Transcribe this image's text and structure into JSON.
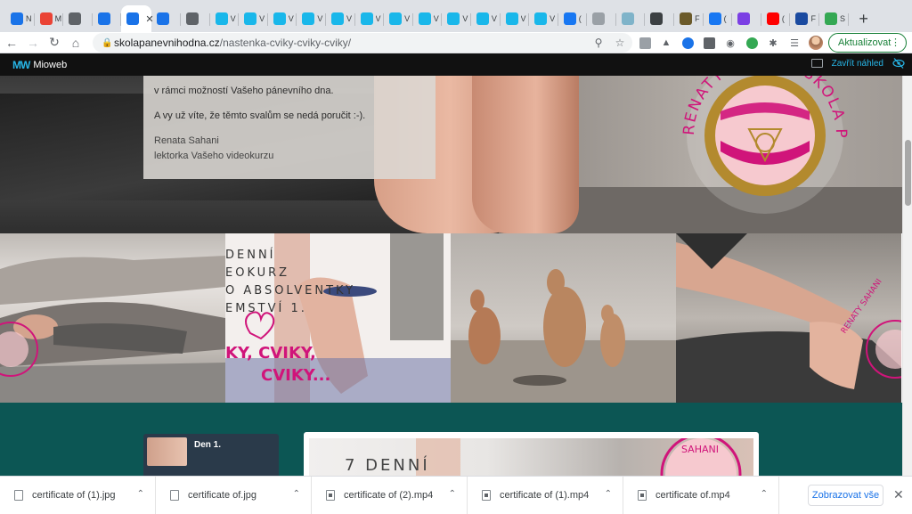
{
  "browser": {
    "tabs": [
      {
        "icon": "mioweb-icon",
        "title": "N",
        "color": "#1a73e8"
      },
      {
        "icon": "gmail-icon",
        "title": "M",
        "color": "#ea4335"
      },
      {
        "icon": "globe-icon",
        "title": "",
        "color": "#5f6368"
      },
      {
        "icon": "mioweb-icon",
        "title": "",
        "color": "#1a73e8"
      },
      {
        "icon": "mioweb-icon",
        "title": "N",
        "color": "#1a73e8",
        "active": true
      },
      {
        "icon": "mioweb-icon",
        "title": "",
        "color": "#1a73e8"
      },
      {
        "icon": "globe-icon",
        "title": "",
        "color": "#5f6368"
      },
      {
        "icon": "vimeo-icon",
        "title": "V",
        "color": "#19b7ea"
      },
      {
        "icon": "vimeo-icon",
        "title": "V",
        "color": "#19b7ea"
      },
      {
        "icon": "vimeo-icon",
        "title": "V",
        "color": "#19b7ea"
      },
      {
        "icon": "vimeo-icon",
        "title": "V",
        "color": "#19b7ea"
      },
      {
        "icon": "vimeo-icon",
        "title": "V",
        "color": "#19b7ea"
      },
      {
        "icon": "vimeo-icon",
        "title": "V",
        "color": "#19b7ea"
      },
      {
        "icon": "vimeo-icon",
        "title": "V",
        "color": "#19b7ea"
      },
      {
        "icon": "vimeo-icon",
        "title": "V",
        "color": "#19b7ea"
      },
      {
        "icon": "vimeo-icon",
        "title": "V",
        "color": "#19b7ea"
      },
      {
        "icon": "vimeo-icon",
        "title": "V",
        "color": "#19b7ea"
      },
      {
        "icon": "vimeo-icon",
        "title": "V",
        "color": "#19b7ea"
      },
      {
        "icon": "vimeo-icon",
        "title": "V",
        "color": "#19b7ea"
      },
      {
        "icon": "facebook-icon",
        "title": "(",
        "color": "#1877f2"
      },
      {
        "icon": "generic-icon",
        "title": "",
        "color": "#9aa0a6"
      },
      {
        "icon": "generic-icon",
        "title": "",
        "color": "#7fb3c9"
      },
      {
        "icon": "at-icon",
        "title": "",
        "color": "#3c4043"
      },
      {
        "icon": "generic-icon",
        "title": "F",
        "color": "#6b5a2a"
      },
      {
        "icon": "facebook-icon",
        "title": "(",
        "color": "#1877f2"
      },
      {
        "icon": "generic-icon",
        "title": "",
        "color": "#7b3fe4"
      },
      {
        "icon": "youtube-icon",
        "title": "(",
        "color": "#ff0000"
      },
      {
        "icon": "generic-icon",
        "title": "F",
        "color": "#1a4aa0"
      },
      {
        "icon": "generic-icon",
        "title": "S",
        "color": "#34a853"
      }
    ],
    "new_tab_label": "+",
    "url_host": "skolapanevnihodna.cz",
    "url_path": "/nastenka-cviky-cviky-cviky/",
    "update_label": "Aktualizovat"
  },
  "mioweb": {
    "logo_text": "Mioweb",
    "close_preview_label": "Zavřít náhled"
  },
  "content": {
    "intro_line": "v rámci možností Vašeho pánevního dna.",
    "line2": "A vy už víte, že těmto svalům se nedá poručit :-).",
    "signature_name": "Renata Sahani",
    "signature_role": "lektorka Vašeho videokurzu",
    "badge_text": "RENATY SAHANI ŠKOLA PÁNEVNÍHO",
    "gallery_card_text": [
      "DENNÍ",
      "EOKURZ",
      "O ABSOLVENTKY",
      "EMSTVÍ 1.",
      "KY, CVIKY,",
      "CVIKY..."
    ],
    "gallery_badge_text": "RENATY SAHANI",
    "lesson_label": "Den 1.",
    "video_title": "7 DENNÍ",
    "video_badge": "SAHANI"
  },
  "downloads": {
    "items": [
      {
        "name": "certificate of (1).jpg",
        "type": "image"
      },
      {
        "name": "certificate of.jpg",
        "type": "image"
      },
      {
        "name": "certificate of (2).mp4",
        "type": "video"
      },
      {
        "name": "certificate of (1).mp4",
        "type": "video"
      },
      {
        "name": "certificate of.mp4",
        "type": "video"
      }
    ],
    "show_all_label": "Zobrazovat vše"
  },
  "colors": {
    "accent_teal": "#0c5654",
    "badge_pink": "#d0147a",
    "badge_gold": "#b38a2e",
    "update_green": "#188038",
    "mioweb_blue": "#27b5e6"
  }
}
